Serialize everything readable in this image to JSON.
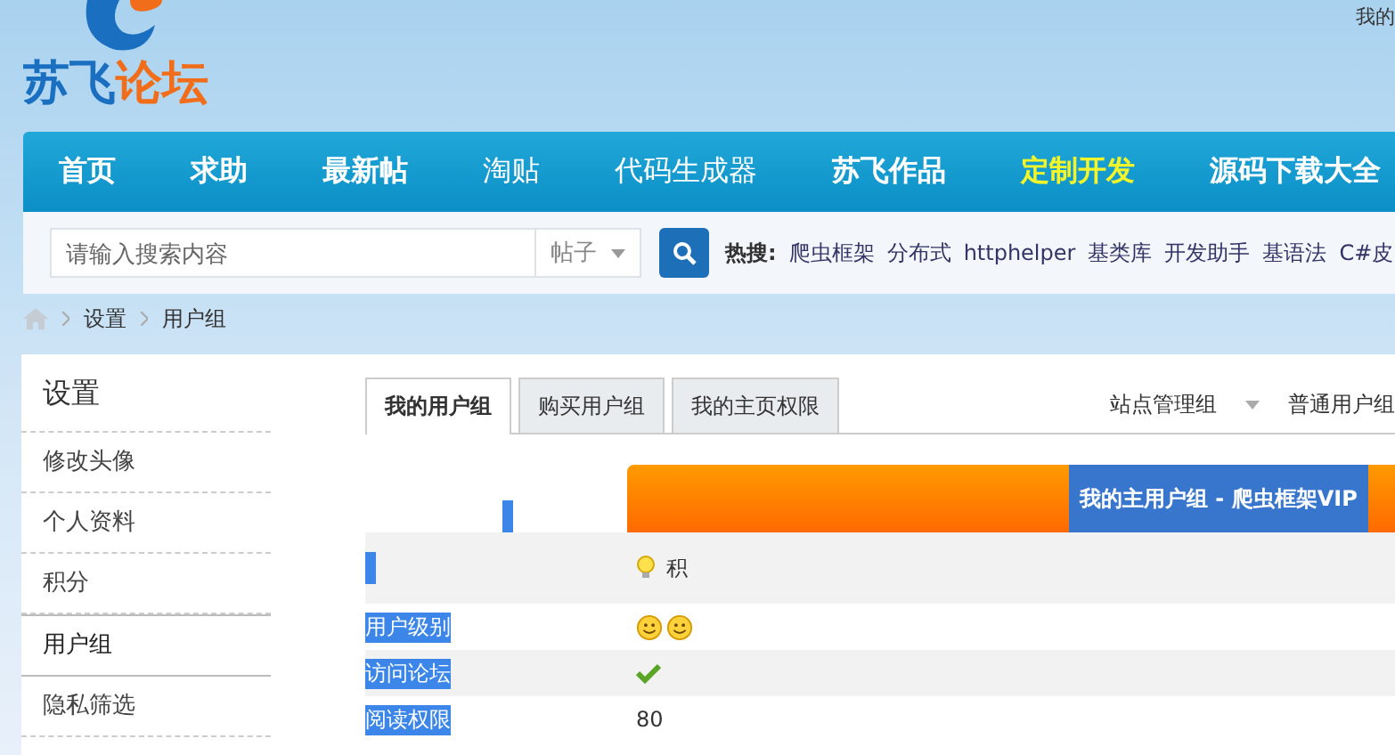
{
  "header": {
    "logo_parts": [
      {
        "text": "苏飞",
        "color": "#1a6fc0"
      },
      {
        "text": "论坛",
        "color": "#f26d1a"
      }
    ],
    "top_link": "我的"
  },
  "nav": [
    {
      "label": "首页",
      "bold": true,
      "highlight": false
    },
    {
      "label": "求助",
      "bold": true,
      "highlight": false
    },
    {
      "label": "最新帖",
      "bold": true,
      "highlight": false
    },
    {
      "label": "淘贴",
      "bold": false,
      "highlight": false
    },
    {
      "label": "代码生成器",
      "bold": false,
      "highlight": false
    },
    {
      "label": "苏飞作品",
      "bold": true,
      "highlight": false
    },
    {
      "label": "定制开发",
      "bold": true,
      "highlight": true
    },
    {
      "label": "源码下载大全",
      "bold": true,
      "highlight": false
    }
  ],
  "search": {
    "placeholder": "请输入搜索内容",
    "scope": "帖子",
    "hot_label": "热搜:",
    "hot": [
      "爬虫框架",
      "分布式",
      "httphelper",
      "基类库",
      "开发助手",
      "基语法",
      "C#皮"
    ]
  },
  "breadcrumb": [
    "设置",
    "用户组"
  ],
  "sidebar": {
    "title": "设置",
    "items": [
      {
        "label": "修改头像",
        "selected": false
      },
      {
        "label": "个人资料",
        "selected": false
      },
      {
        "label": "积分",
        "selected": false
      },
      {
        "label": "用户组",
        "selected": true
      },
      {
        "label": "隐私筛选",
        "selected": false
      }
    ]
  },
  "tabs": [
    {
      "label": "我的用户组",
      "selected": true
    },
    {
      "label": "购买用户组",
      "selected": false
    },
    {
      "label": "我的主页权限",
      "selected": false
    }
  ],
  "group_links": [
    {
      "label": "站点管理组",
      "dropdown": true
    },
    {
      "label": "普通用户组",
      "dropdown": false
    }
  ],
  "table": {
    "header": "我的主用户组 - 爬虫框架VIP",
    "points_label": "积",
    "rows": [
      {
        "label": "用户级别",
        "highlighted": true,
        "kind": "smileys"
      },
      {
        "label": "访问论坛",
        "highlighted": true,
        "kind": "check"
      },
      {
        "label": "阅读权限",
        "highlighted": true,
        "kind": "text",
        "value": "80"
      }
    ]
  }
}
